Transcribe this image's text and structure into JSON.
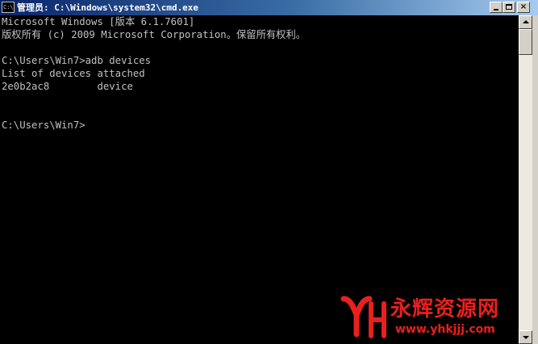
{
  "window": {
    "title": "管理员: C:\\Windows\\system32\\cmd.exe",
    "icon_label": "C:\\",
    "controls": {
      "minimize": "minimize-icon",
      "maximize": "maximize-icon",
      "close": "×"
    }
  },
  "console": {
    "lines": [
      "Microsoft Windows [版本 6.1.7601]",
      "版权所有 (c) 2009 Microsoft Corporation。保留所有权利。",
      "",
      "C:\\Users\\Win7>adb devices",
      "List of devices attached",
      "2e0b2ac8        device",
      "",
      "",
      "C:\\Users\\Win7>"
    ]
  },
  "watermark": {
    "name": "永辉资源网",
    "url": "www.yhkjjj.com"
  },
  "colors": {
    "console_bg": "#000000",
    "console_fg": "#c0c0c0",
    "title_active": "#0a246a",
    "watermark_red": "#e8201e"
  }
}
